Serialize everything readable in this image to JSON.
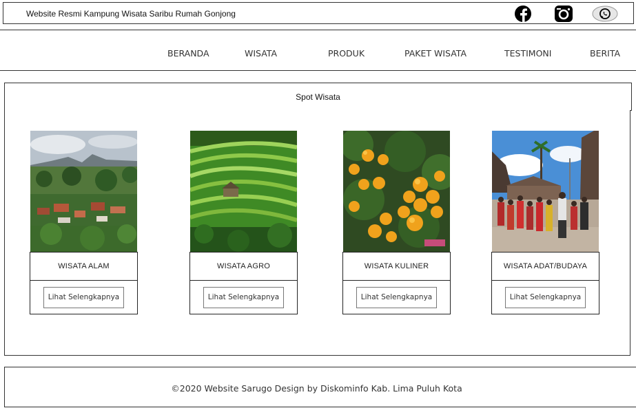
{
  "topbar": {
    "title": "Website Resmi Kampung Wisata Saribu Rumah Gonjong",
    "social": [
      "facebook-icon",
      "instagram-icon",
      "whatsapp-icon"
    ]
  },
  "nav": {
    "items": [
      "BERANDA",
      "WISATA",
      "PRODUK",
      "PAKET WISATA",
      "TESTIMONI",
      "BERITA"
    ]
  },
  "section": {
    "title": "Spot Wisata"
  },
  "cards": [
    {
      "label": "WISATA  ALAM",
      "button": "Lihat Selengkapnya",
      "image": "mountain-village-photo"
    },
    {
      "label": "WISATA  AGRO",
      "button": "Lihat Selengkapnya",
      "image": "rice-terrace-photo"
    },
    {
      "label": "WISATA  KULINER",
      "button": "Lihat Selengkapnya",
      "image": "orange-tree-photo"
    },
    {
      "label": "WISATA  ADAT/BUDAYA",
      "button": "Lihat Selengkapnya",
      "image": "traditional-ceremony-photo"
    }
  ],
  "footer": {
    "text": "©2020 Website Sarugo Design by Diskominfo Kab. Lima Puluh Kota"
  }
}
